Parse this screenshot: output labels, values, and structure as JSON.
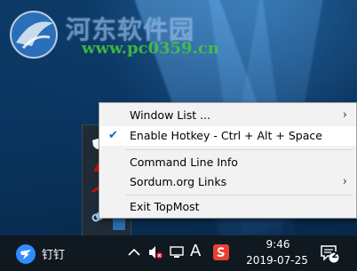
{
  "watermark": {
    "title": "河东软件园",
    "url": "www.pc0359.cn"
  },
  "menu": {
    "items": [
      {
        "label": "Window List ...",
        "checked": false,
        "submenu": true
      },
      {
        "label": "Enable Hotkey - Ctrl + Alt + Space",
        "checked": true,
        "submenu": false
      },
      {
        "label": "Command Line Info",
        "checked": false,
        "submenu": false
      },
      {
        "label": "Sordum.org Links",
        "checked": false,
        "submenu": true
      },
      {
        "label": "Exit TopMost",
        "checked": false,
        "submenu": false
      }
    ],
    "check_glyph": "✔",
    "arrow_glyph": "›"
  },
  "taskbar": {
    "app_label": "钉钉",
    "ime_label": "A",
    "time": "9:46",
    "date": "2019-07-25",
    "notification_count": "2",
    "icons": [
      "dingtalk-icon",
      "chevron-up-icon",
      "volume-muted-icon",
      "network-icon",
      "ime-icon",
      "sogou-icon",
      "action-center-icon"
    ]
  },
  "colors": {
    "accent": "#0067c0",
    "taskbar": "#101820",
    "menu_bg": "#f2f2f2",
    "sogou_red": "#e8402e"
  }
}
